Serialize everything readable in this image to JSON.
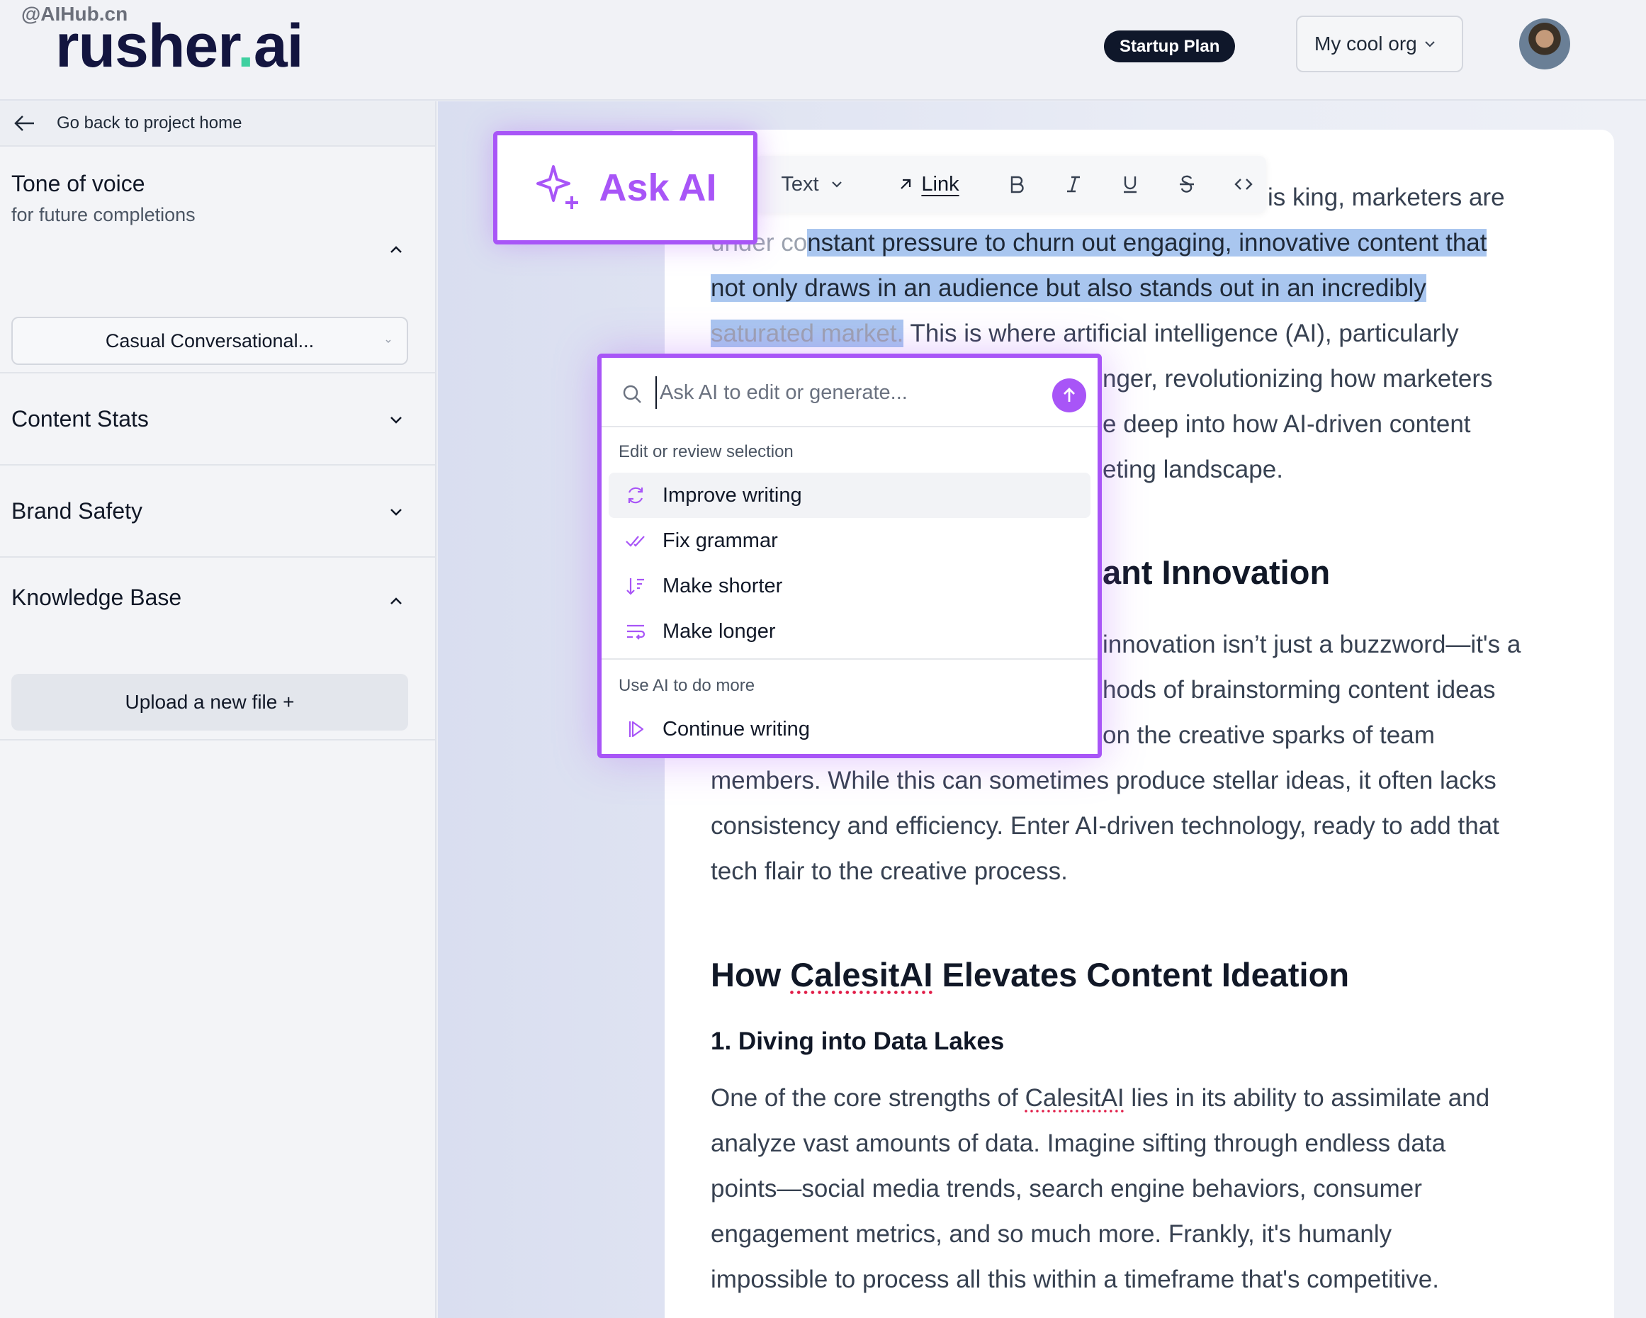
{
  "header": {
    "watermark": "@AIHub.cn",
    "logo_main": "rusher",
    "logo_dot": ".",
    "logo_suffix": "ai",
    "plan_badge": "Startup Plan",
    "org_selector": "My cool org"
  },
  "sidebar": {
    "back_link": "Go back to project home",
    "tone": {
      "title": "Tone of voice",
      "subtitle": "for future completions",
      "selected": "Casual Conversational..."
    },
    "content_stats": "Content Stats",
    "brand_safety": "Brand Safety",
    "knowledge_base": "Knowledge Base",
    "upload_button": "Upload a new file +"
  },
  "toolbar": {
    "ask_ai": "Ask AI",
    "text_style": "Text",
    "link": "Link"
  },
  "ai_menu": {
    "placeholder": "Ask AI to edit or generate...",
    "group_edit": "Edit or review selection",
    "items_edit": [
      "Improve writing",
      "Fix grammar",
      "Make shorter",
      "Make longer"
    ],
    "group_more": "Use AI to do more",
    "items_more": [
      "Continue writing"
    ]
  },
  "document": {
    "p1_l1": "is king, marketers are",
    "p1_l2a": "under co",
    "p1_l2b": "nstant pressure to churn out engaging, innovative content that",
    "p1_l3": "not only draws in an audience but also stands out in an incredibly",
    "p1_l4a": "saturated market.",
    "p1_l4b": " This is where artificial intelligence (AI), particularly",
    "p1_l5": "nger, revolutionizing how marketers",
    "p1_l6": "e deep into how AI-driven content",
    "p1_l7": "eting landscape.",
    "h2_partial": "ant Innovation",
    "p2_l1": "innovation isn’t just a buzzword—it's a",
    "p2_l2": "hods of brainstorming content ideas",
    "p2_l3": "on the creative sparks of team",
    "p2_l4": "members. While this can sometimes produce stellar ideas, it often lacks",
    "p2_l5": "consistency and efficiency. Enter AI-driven technology, ready to add that",
    "p2_l6": "tech flair to the creative process.",
    "h2_b_pre": "How ",
    "h2_b_brand": "CalesitAI",
    "h2_b_post": " Elevates Content Ideation",
    "h3": "1. Diving into Data Lakes",
    "p3_l1_pre": "One of the core strengths of ",
    "p3_l1_brand": "CalesitAI",
    "p3_l1_post": " lies in its ability to assimilate and",
    "p3_l2": "analyze vast amounts of data. Imagine sifting through endless data",
    "p3_l3": "points—social media trends, search engine behaviors, consumer",
    "p3_l4": "engagement metrics, and so much more. Frankly, it's humanly",
    "p3_l5": "impossible to process all this within a timeframe that's competitive."
  },
  "colors": {
    "accent": "#a855f7",
    "selection": "#a9c6ef",
    "brand_navy": "#13153f",
    "brand_dot": "#3fd0a0"
  }
}
